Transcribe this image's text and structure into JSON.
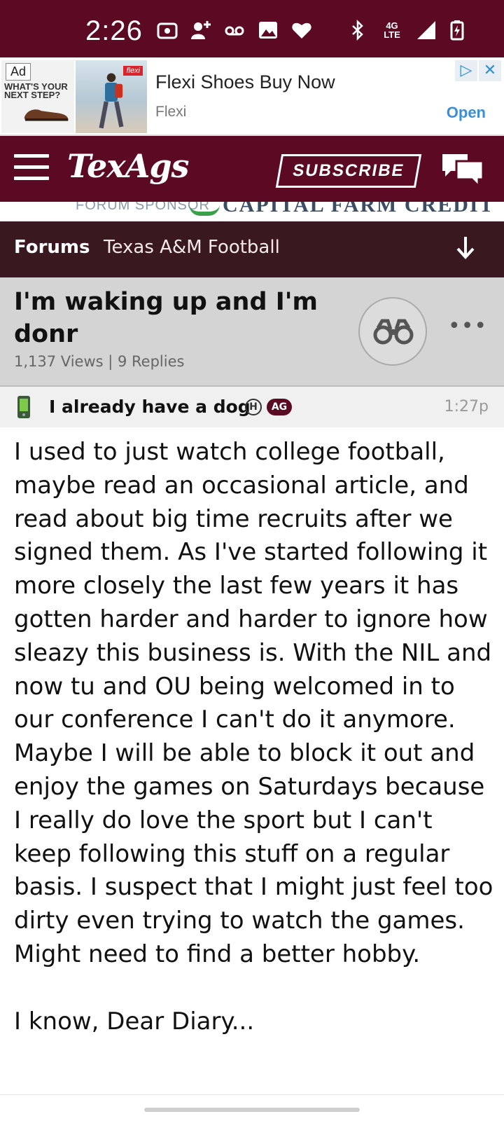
{
  "status_bar": {
    "time": "2:26",
    "network": "4G LTE",
    "icons": [
      "radio-icon",
      "add-contact-icon",
      "voicemail-icon",
      "image-icon",
      "heart-icon",
      "bluetooth-icon",
      "signal-icon",
      "battery-charging-icon"
    ],
    "background": "#5c0a23"
  },
  "ad": {
    "label": "Ad",
    "slogan": "WHAT'S YOUR NEXT STEP?",
    "title": "Flexi Shoes Buy Now",
    "advertiser": "Flexi",
    "cta": "Open",
    "brand_tag": "flexi"
  },
  "header": {
    "logo": "TexAgs",
    "subscribe_label": "SUBSCRIBE",
    "brand_color": "#5c0a23"
  },
  "sponsor": {
    "label": "FORUM SPONSOR",
    "name": "CAPITAL FARM CREDIT"
  },
  "breadcrumb": {
    "root": "Forums",
    "board": "Texas A&M Football"
  },
  "thread": {
    "title": "I'm waking up and I'm donr",
    "stats": "1,137 Views | 9 Replies"
  },
  "post": {
    "author": "I already have a dog",
    "badge_h": "H",
    "badge_ag": "AG",
    "time": "1:27p",
    "body": "I used to just watch college football, maybe read an occasional article, and read about big time recruits after we signed them. As I've started following it more closely the last few years it has gotten harder and harder to ignore how sleazy this business is. With the NIL and now tu and OU being welcomed in to our conference I can't do it anymore. Maybe I will be able to block it out and enjoy the games on Saturdays because I really do love the sport but I can't keep following this stuff on a regular basis. I suspect that I might just feel too dirty even trying to watch the games. Might need to find a better hobby.",
    "signoff": "I know, Dear Diary..."
  }
}
